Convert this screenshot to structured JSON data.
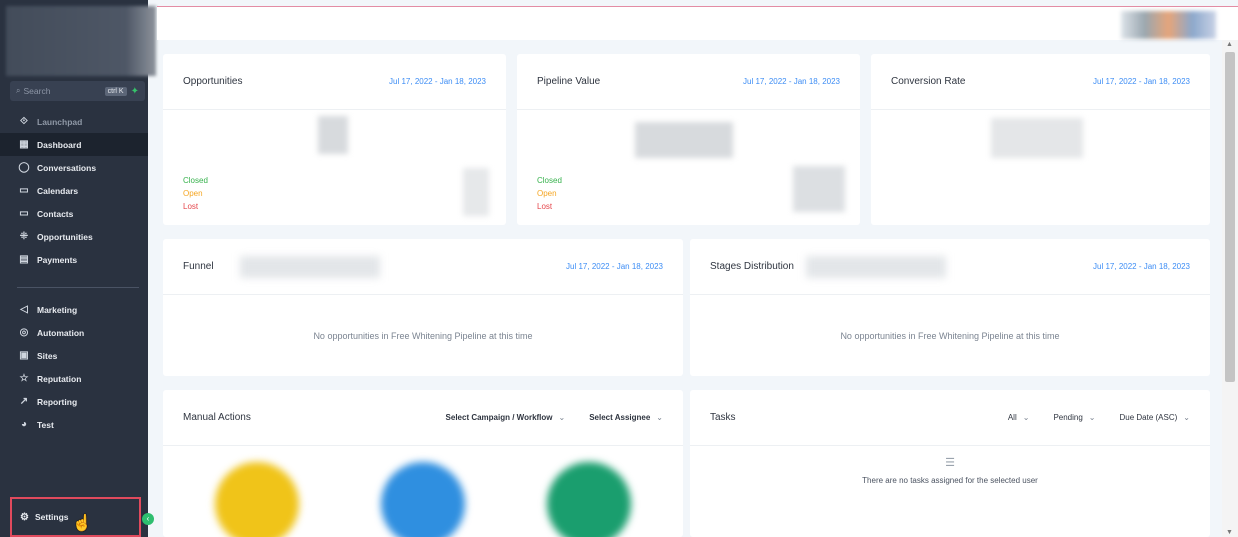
{
  "sidebar": {
    "search_placeholder": "Search",
    "search_shortcut": "ctrl K",
    "nav_primary": [
      {
        "label": "Launchpad",
        "icon": "rocket-icon",
        "glyph": "⟐",
        "active": false,
        "dim": true
      },
      {
        "label": "Dashboard",
        "icon": "dashboard-icon",
        "glyph": "▦",
        "active": true,
        "dim": false
      },
      {
        "label": "Conversations",
        "icon": "chat-icon",
        "glyph": "◯",
        "active": false,
        "dim": false
      },
      {
        "label": "Calendars",
        "icon": "calendar-icon",
        "glyph": "▭",
        "active": false,
        "dim": false
      },
      {
        "label": "Contacts",
        "icon": "contacts-icon",
        "glyph": "▭",
        "active": false,
        "dim": false
      },
      {
        "label": "Opportunities",
        "icon": "opportunities-icon",
        "glyph": "⁜",
        "active": false,
        "dim": false
      },
      {
        "label": "Payments",
        "icon": "payments-icon",
        "glyph": "▤",
        "active": false,
        "dim": false
      }
    ],
    "nav_secondary": [
      {
        "label": "Marketing",
        "icon": "send-icon",
        "glyph": "◁",
        "active": false,
        "dim": false
      },
      {
        "label": "Automation",
        "icon": "automation-icon",
        "glyph": "◎",
        "active": false,
        "dim": false
      },
      {
        "label": "Sites",
        "icon": "sites-icon",
        "glyph": "▣",
        "active": false,
        "dim": false
      },
      {
        "label": "Reputation",
        "icon": "star-icon",
        "glyph": "☆",
        "active": false,
        "dim": false
      },
      {
        "label": "Reporting",
        "icon": "chart-line-icon",
        "glyph": "↗",
        "active": false,
        "dim": false
      },
      {
        "label": "Test",
        "icon": "test-icon",
        "glyph": "◕",
        "active": false,
        "dim": false
      }
    ],
    "settings_label": "Settings"
  },
  "cards": {
    "opportunities": {
      "title": "Opportunities",
      "date": "Jul 17, 2022 - Jan 18, 2023",
      "closed": "Closed",
      "open": "Open",
      "lost": "Lost"
    },
    "pipeline_value": {
      "title": "Pipeline Value",
      "date": "Jul 17, 2022 - Jan 18, 2023",
      "closed": "Closed",
      "open": "Open",
      "lost": "Lost"
    },
    "conversion_rate": {
      "title": "Conversion Rate",
      "date": "Jul 17, 2022 - Jan 18, 2023"
    },
    "funnel": {
      "title": "Funnel",
      "date": "Jul 17, 2022 - Jan 18, 2023",
      "empty": "No opportunities in Free Whitening Pipeline at this time"
    },
    "stages": {
      "title": "Stages Distribution",
      "date": "Jul 17, 2022 - Jan 18, 2023",
      "empty": "No opportunities in Free Whitening Pipeline at this time"
    },
    "manual_actions": {
      "title": "Manual Actions",
      "campaign_select": "Select Campaign / Workflow",
      "assignee_select": "Select Assignee"
    },
    "tasks": {
      "title": "Tasks",
      "filter_all": "All",
      "filter_status": "Pending",
      "sort": "Due Date (ASC)",
      "empty": "There are no tasks assigned for the selected user"
    }
  },
  "colors": {
    "closed": "#37b24d",
    "open": "#f5a623",
    "lost": "#e5484d",
    "accent": "#3d8df5",
    "highlight": "#e04a5d"
  }
}
